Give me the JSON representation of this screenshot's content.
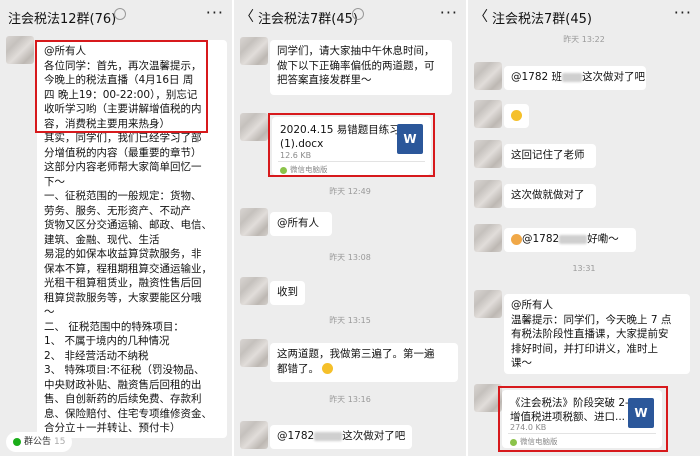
{
  "panel1": {
    "title": "注会税法12群(76)",
    "notice_label": "群公告",
    "notice_count": "15",
    "message_lines": [
      "@所有人",
      "各位同学：首先，再次温馨提示，",
      "今晚上的税法直播（4月16日 周",
      "四 晚上19：00-22:00），别忘记",
      "收听学习哟（主要讲解增值税的内",
      "容，消费税主要用来热身）",
      "其实，同学们，我们已经学习了部",
      "分增值税的内容（最重要的章节）",
      "这部分内容老师帮大家简单回忆一",
      "下～",
      "一、征税范围的一般规定：货物、",
      "劳务、服务、无形资产、不动产",
      "货物又区分交通运输、邮政、电信、",
      "建筑、金融、现代、生活",
      "易混的如保本收益算贷款服务，非",
      "保本不算，程租期租算交通运输业，",
      "光租干租算租赁业，融资性售后回",
      "租算贷款服务等，大家要能区分哦",
      "～",
      "二、    征税范围中的特殊项目：",
      "1、 不属于境内的几种情况",
      "2、 非经营活动不纳税",
      "3、 特殊项目:不征税（罚没物品、",
      "中央财政补贴、融资售后回租的出",
      "售、自创新药的后续免费、存款利",
      "息、保险赔付、住宅专项维修资金、",
      "合分立＋一并转让、预付卡）"
    ]
  },
  "panel2": {
    "title": "注会税法7群(45)",
    "msg1_lines": [
      "同学们，请大家抽中午休息时间，",
      "做下以下正确率偏低的两道题，可",
      "把答案直接发群里～"
    ],
    "file_name_1": "2020.4.15 易错题目练习",
    "file_name_2": "(1).docx",
    "file_size": "12.6 KB",
    "file_source": "微信电脑版",
    "file_icon_letter": "W",
    "time1": "昨天 12:49",
    "msg2": "@所有人",
    "time2": "昨天 13:08",
    "msg3": "收到",
    "time3": "昨天 13:15",
    "msg4_line1": "这两道题，我做第三遍了。第一遍",
    "msg4_line2": "都错了。",
    "time4": "昨天 13:16",
    "msg5_prefix": "@1782",
    "msg5_suffix": "这次做对了吧"
  },
  "panel3": {
    "title": "注会税法7群(45)",
    "time1": "昨天 13:22",
    "msg1_prefix": "@1782 班",
    "msg1_suffix": "这次做对了吧",
    "msg3": "这回记住了老师",
    "msg4": "这次做就做对了",
    "msg5_prefix": "@1782",
    "msg5_suffix": "好嘞～",
    "time2": "13:31",
    "msg6_lines": [
      "@所有人",
      "温馨提示：同学们，今天晚上 7 点",
      "有税法阶段性直播课，大家提前安",
      "排好时间，并打印讲义，准时上",
      "课～"
    ],
    "file_name_1": "《注会税法》阶段突破 2-",
    "file_name_2": "增值税进项税额、进口...",
    "file_size": "274.0 KB",
    "file_source": "微信电脑版",
    "file_icon_letter": "W"
  },
  "colors": {
    "highlight": "#d7191c",
    "background": "#ededed",
    "bubble": "#ffffff",
    "word": "#2b579a"
  }
}
